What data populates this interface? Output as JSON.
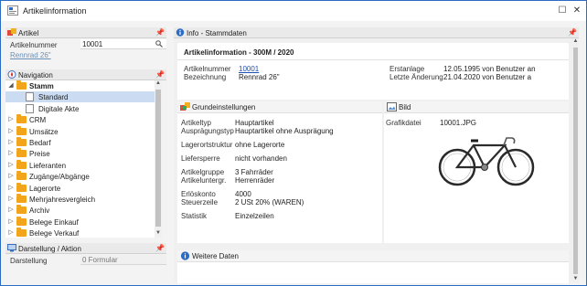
{
  "window": {
    "title": "Artikelinformation",
    "maximize_glyph": "☐",
    "close_glyph": "✕"
  },
  "left": {
    "artikel_group": {
      "title": "Artikel",
      "pin": "📌",
      "fields": [
        {
          "label": "Artikelnummer",
          "value": "10001"
        }
      ],
      "description": "Rennrad 26\""
    },
    "navigation": {
      "title": "Navigation",
      "pin": "📌",
      "items": [
        {
          "label": "Stamm",
          "level": 0,
          "expanded": true,
          "kind": "folder",
          "bold": true
        },
        {
          "label": "Standard",
          "level": 1,
          "kind": "page",
          "selected": true
        },
        {
          "label": "Digitale Akte",
          "level": 1,
          "kind": "page"
        },
        {
          "label": "CRM",
          "level": 0,
          "expanded": false,
          "kind": "folder"
        },
        {
          "label": "Umsätze",
          "level": 0,
          "kind": "folder"
        },
        {
          "label": "Bedarf",
          "level": 0,
          "kind": "folder"
        },
        {
          "label": "Preise",
          "level": 0,
          "kind": "folder"
        },
        {
          "label": "Lieferanten",
          "level": 0,
          "kind": "folder"
        },
        {
          "label": "Zugänge/Abgänge",
          "level": 0,
          "expanded": false,
          "kind": "folder"
        },
        {
          "label": "Lagerorte",
          "level": 0,
          "kind": "folder"
        },
        {
          "label": "Mehrjahresvergleich",
          "level": 0,
          "kind": "folder"
        },
        {
          "label": "Archiv",
          "level": 0,
          "expanded": false,
          "kind": "folder"
        },
        {
          "label": "Belege Einkauf",
          "level": 0,
          "expanded": false,
          "kind": "folder"
        },
        {
          "label": "Belege Verkauf",
          "level": 0,
          "expanded": false,
          "kind": "folder"
        }
      ]
    },
    "darstellung": {
      "title": "Darstellung / Aktion",
      "pin": "📌",
      "field": {
        "label": "Darstellung",
        "value": "0 Formular"
      }
    }
  },
  "right": {
    "header": {
      "title": "Info - Stammdaten",
      "pin": "📌"
    },
    "card_title": "Artikelinformation - 300M / 2020",
    "top_left": [
      {
        "label": "Artikelnummer",
        "value": "10001",
        "link": true
      },
      {
        "label": "Bezeichnung",
        "value": "Rennrad 26\""
      }
    ],
    "top_right": [
      {
        "label": "Erstanlage",
        "value": "12.05.1995  von Benutzer an"
      },
      {
        "label": "Letzte Änderung",
        "value": "21.04.2020  von Benutzer a"
      }
    ],
    "grund": {
      "title": "Grundeinstellungen",
      "rows": [
        {
          "label": "Artikeltyp",
          "value": "Hauptartikel"
        },
        {
          "label": "Ausprägungstyp",
          "value": "Hauptartikel ohne Ausprägung"
        },
        {
          "label": "Lagerortstruktur",
          "value": "ohne Lagerorte"
        },
        {
          "label": "Liefersperre",
          "value": "nicht vorhanden"
        },
        {
          "label": "Artikelgruppe",
          "value": "3  Fahrräder"
        },
        {
          "label": "Artikeluntergr.",
          "value": "Herrenräder"
        },
        {
          "label": "Erlöskonto",
          "value": "4000"
        },
        {
          "label": "Steuerzeile",
          "value": "2  USt 20% (WAREN)"
        },
        {
          "label": "Statistik",
          "value": "Einzelzeilen"
        }
      ]
    },
    "bild": {
      "title": "Bild",
      "label": "Grafikdatei",
      "value": "10001.JPG"
    },
    "weitere": {
      "title": "Weitere Daten"
    }
  },
  "colors": {
    "accent": "#2b6cc4",
    "selected": "#cbdcf2",
    "folder": "#f2a51a",
    "link": "#1d4fb5",
    "pin": "#c00000"
  }
}
